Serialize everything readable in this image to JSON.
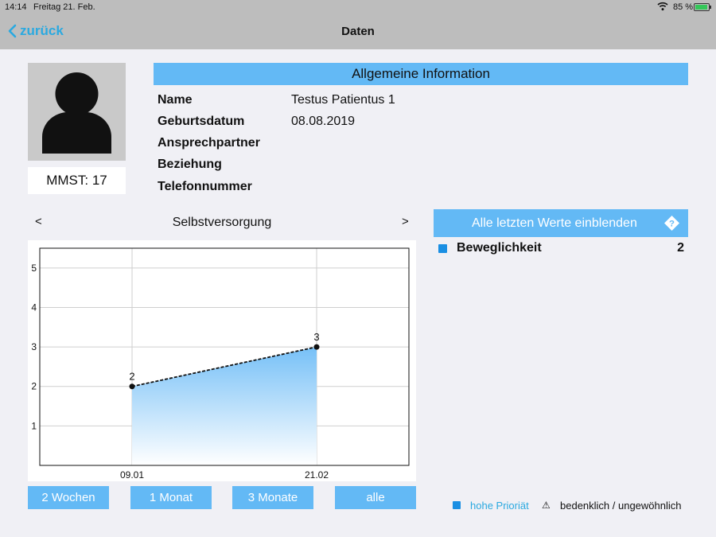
{
  "status": {
    "time": "14:14",
    "date": "Freitag 21. Feb.",
    "battery": "85 %"
  },
  "nav": {
    "back_label": "zurück",
    "title": "Daten"
  },
  "profile": {
    "mmst": "MMST: 17"
  },
  "info": {
    "header": "Allgemeine Information",
    "rows": [
      {
        "label": "Name",
        "value": "Testus Patientus 1"
      },
      {
        "label": "Geburtsdatum",
        "value": "08.08.2019"
      },
      {
        "label": "Ansprechpartner",
        "value": ""
      },
      {
        "label": "Beziehung",
        "value": ""
      },
      {
        "label": "Telefonnummer",
        "value": ""
      }
    ]
  },
  "chart_nav": {
    "prev": "<",
    "next": ">",
    "title": "Selbstversorgung"
  },
  "chart_data": {
    "type": "area",
    "x": [
      "09.01",
      "21.02"
    ],
    "values": [
      2,
      3
    ],
    "data_labels": [
      "2",
      "3"
    ],
    "yticks": [
      "1",
      "2",
      "3",
      "4",
      "5"
    ],
    "ylim": [
      0,
      5.5
    ],
    "grid": true,
    "colors": {
      "fill_top": "#76c0f7",
      "fill_bottom": "#ffffff",
      "line": "#111111"
    }
  },
  "ranges": [
    "2 Wochen",
    "1 Monat",
    "3 Monate",
    "alle"
  ],
  "show_all_label": "Alle letzten Werte einblenden",
  "items": [
    {
      "name": "Beweglichkeit",
      "value": "2"
    }
  ],
  "legend": {
    "priority": "hohe Prioriät",
    "warning": "bedenklich / ungewöhnlich",
    "warning_icon": "⚠"
  },
  "colors": {
    "accent": "#63b9f5",
    "link": "#2aa9e0",
    "marker": "#1a8fe3"
  }
}
